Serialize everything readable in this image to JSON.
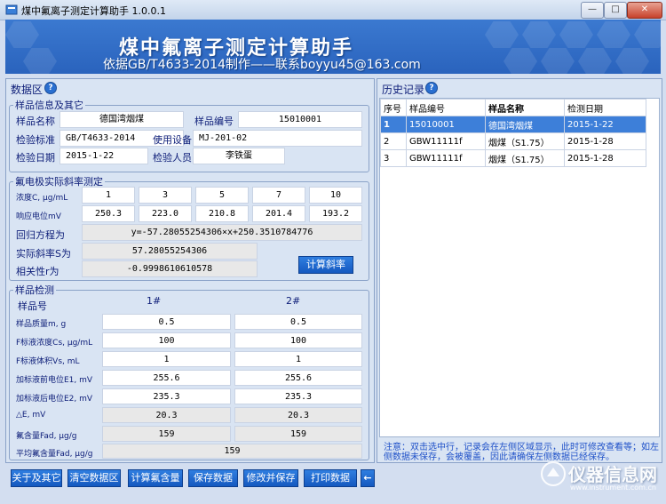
{
  "window": {
    "title": "煤中氟离子测定计算助手 1.0.0.1",
    "controls": [
      "—",
      "□",
      "✕"
    ]
  },
  "banner": {
    "title": "煤中氟离子测定计算助手",
    "subtitle": "依据GB/T4633-2014制作——联系boyyu45@163.com"
  },
  "data_area": {
    "title": "数据区",
    "sample_info": {
      "legend": "样品信息及其它",
      "name_label": "样品名称",
      "name_value": "德国湾烟煤",
      "id_label": "样品编号",
      "id_value": "15010001",
      "standard_label": "检验标准",
      "standard_value": "GB/T4633-2014",
      "device_label": "使用设备",
      "device_value": "MJ-201-02",
      "date_label": "检验日期",
      "date_value": "2015-1-22",
      "inspector_label": "检验人员",
      "inspector_value": "李铁蛋"
    },
    "slope": {
      "legend": "氟电极实际斜率测定",
      "conc_label": "浓度C, μg/mL",
      "conc_values": [
        "1",
        "3",
        "5",
        "7",
        "10"
      ],
      "potential_label": "响应电位mV",
      "potential_values": [
        "250.3",
        "223.0",
        "210.8",
        "201.4",
        "193.2"
      ],
      "regression_label": "回归方程为",
      "regression_value": "y=-57.28055254306×x+250.3510784776",
      "actual_slope_label": "实际斜率S为",
      "actual_slope_value": "57.28055254306",
      "correlation_label": "相关性r为",
      "correlation_value": "-0.9998610610578",
      "calc_button": "计算斜率"
    },
    "detection": {
      "legend": "样品检测",
      "sample_no_label": "样品号",
      "col1": "1#",
      "col2": "2#",
      "rows": [
        {
          "label": "样品质量m, g",
          "v1": "0.5",
          "v2": "0.5",
          "gray": false
        },
        {
          "label": "F标液浓度Cs, μg/mL",
          "v1": "100",
          "v2": "100",
          "gray": false
        },
        {
          "label": "F标液体积Vs, mL",
          "v1": "1",
          "v2": "1",
          "gray": false
        },
        {
          "label": "加标液前电位E1, mV",
          "v1": "255.6",
          "v2": "255.6",
          "gray": false
        },
        {
          "label": "加标液后电位E2, mV",
          "v1": "235.3",
          "v2": "235.3",
          "gray": false
        },
        {
          "label": "△E, mV",
          "v1": "20.3",
          "v2": "20.3",
          "gray": true
        },
        {
          "label": "氟含量Fad, μg/g",
          "v1": "159",
          "v2": "159",
          "gray": true
        }
      ],
      "avg_label": "平均氟含量Fad, μg/g",
      "avg_value": "159"
    }
  },
  "history": {
    "title": "历史记录",
    "headers": [
      "序号",
      "样品编号",
      "样品名称",
      "检测日期"
    ],
    "rows": [
      {
        "idx": "1",
        "id": "15010001",
        "name": "德国湾烟煤",
        "date": "2015-1-22",
        "selected": true
      },
      {
        "idx": "2",
        "id": "GBW11111f",
        "name": "烟煤（S1.75）",
        "date": "2015-1-28",
        "selected": false
      },
      {
        "idx": "3",
        "id": "GBW11111f",
        "name": "烟煤（S1.75）",
        "date": "2015-1-28",
        "selected": false
      }
    ],
    "note": "注意：双击选中行，记录会在左侧区域显示，此时可修改查看等；如左侧数据未保存，会被覆盖，因此请确保左侧数据已经保存。"
  },
  "bottom_buttons": [
    "关于及其它",
    "清空数据区",
    "计算氟含量",
    "保存数据",
    "修改并保存",
    "打印数据"
  ],
  "arrow_button": "←",
  "watermark": {
    "text": "仪器信息网",
    "url": "www.instrument.com.cn"
  },
  "colors": {
    "button_blue": "#1f6ad4",
    "selected_row": "#3d7fd9",
    "banner": "#2f6cc8"
  }
}
